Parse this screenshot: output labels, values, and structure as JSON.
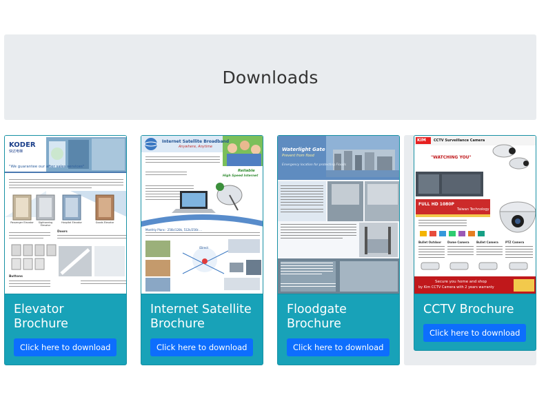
{
  "page": {
    "title": "Downloads"
  },
  "cards": [
    {
      "title_line1": "Elevator",
      "title_line2": "Brochure",
      "button": "Click here to download",
      "thumb": {
        "logo": "KODER",
        "logo_sub": "快达电梯",
        "tagline": "\"We guarantee our after sales services\"",
        "labels": [
          "Passenger Elevator",
          "Sightseeing Elevator",
          "Hospital Elevator",
          "Goods Elevator"
        ],
        "section_doors": "Doors",
        "section_buttons": "Buttons"
      }
    },
    {
      "title_line1": "Internet Satellite",
      "title_line2": "Brochure",
      "button": "Click here to download",
      "thumb": {
        "heading": "Internet Satellite Broadband",
        "subheading": "Anywhere, Anytime",
        "badge_line1": "Reliable",
        "badge_line2": "High Speed Internet",
        "plans": "Monthly Plans : 256k/128k, 512k/256k ...",
        "map_label": "iDirect"
      }
    },
    {
      "title_line1": "Floodgate",
      "title_line2": "Brochure",
      "button": "Click here to download",
      "thumb": {
        "heading": "Waterlight Gate",
        "subheading": "Prevent from flood",
        "side_text": "Emergency location for protecting Floods"
      }
    },
    {
      "title_line1": "CCTV Brochure",
      "title_line2": "",
      "button": "Click here to download",
      "thumb": {
        "brand": "KIM",
        "heading": "CCTV Surveillance Camera",
        "slogan": "\"WATCHING YOU\"",
        "tech": "Taiwan Technology",
        "hd": "FULL HD 1080P",
        "cols": [
          "Bullet Outdoor",
          "Dome Camera",
          "Bullet Camera",
          "PTZ Camera"
        ],
        "footer_line1": "Secure you home and shop",
        "footer_line2": "by Kim CCTV Camera with 2 years warranty"
      }
    }
  ],
  "colors": {
    "card_bg": "#18a2b8",
    "button_bg": "#0d6efd",
    "header_band": "#e9ecef"
  }
}
